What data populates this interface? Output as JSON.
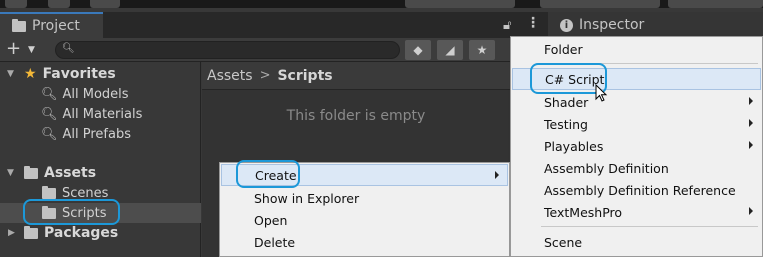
{
  "tabs": {
    "project": "Project",
    "inspector": "Inspector"
  },
  "tree": {
    "favorites": "Favorites",
    "favorite_items": [
      "All Models",
      "All Materials",
      "All Prefabs"
    ],
    "assets": "Assets",
    "asset_folders": [
      "Scenes",
      "Scripts"
    ],
    "packages": "Packages"
  },
  "content": {
    "breadcrumb_root": "Assets",
    "breadcrumb_current": "Scripts",
    "empty_message": "This folder is empty"
  },
  "context_menu": [
    "Create",
    "Show in Explorer",
    "Open",
    "Delete"
  ],
  "create_submenu": [
    "Folder",
    "C# Script",
    "Shader",
    "Testing",
    "Playables",
    "Assembly Definition",
    "Assembly Definition Reference",
    "TextMeshPro",
    "Scene"
  ],
  "colors": {
    "accent": "#1c98d8",
    "highlight": "#dce8f6",
    "favorites_star": "#f3b838"
  }
}
